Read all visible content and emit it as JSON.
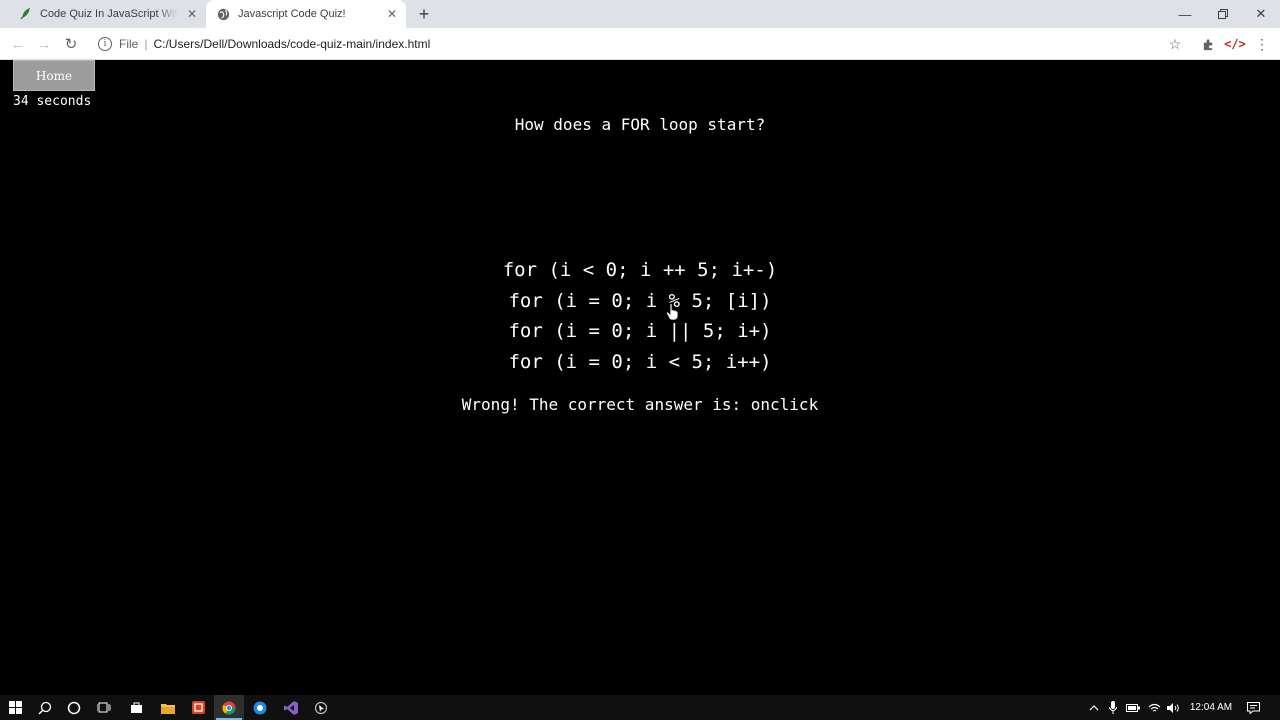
{
  "browser": {
    "tabs": [
      {
        "title": "Code Quiz In JavaScript With Sou",
        "icon": "feather-favicon-icon",
        "active": false
      },
      {
        "title": "Javascript Code Quiz!",
        "icon": "globe-favicon-icon",
        "active": true
      }
    ],
    "omnibox": {
      "scheme": "File",
      "url": "C:/Users/Dell/Downloads/code-quiz-main/index.html"
    }
  },
  "page": {
    "home_label": "Home",
    "timer": "34 seconds",
    "question": "How does a FOR loop start?",
    "choices": [
      "for (i < 0; i ++ 5; i+-)",
      "for (i = 0; i % 5; [i])",
      "for (i = 0; i || 5; i+)",
      "for (i = 0; i < 5; i++)"
    ],
    "feedback": "Wrong! The correct answer is: onclick"
  },
  "taskbar": {
    "clock": "12:04 AM"
  },
  "colors": {
    "page_bg": "#000000",
    "text": "#ffffff",
    "home_button_bg": "#9c9c9c",
    "taskbar_bg": "#101010",
    "tabstrip_bg": "#dee1e6"
  }
}
